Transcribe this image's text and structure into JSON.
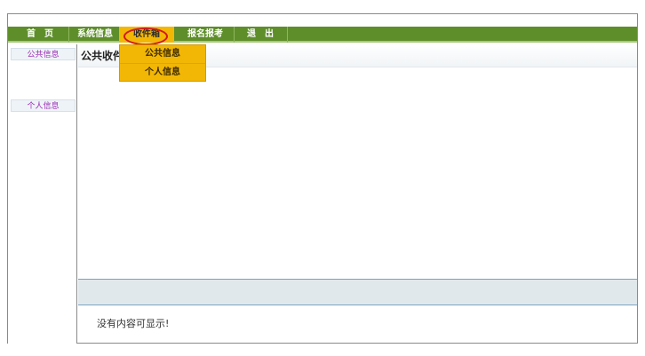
{
  "nav": {
    "items": [
      {
        "label": "首　页"
      },
      {
        "label": "系统信息"
      },
      {
        "label": "收件箱"
      },
      {
        "label": "报名报考"
      },
      {
        "label": "退　出"
      }
    ]
  },
  "dropdown": {
    "items": [
      {
        "label": "公共信息"
      },
      {
        "label": "个人信息"
      }
    ]
  },
  "sidebar": {
    "items": [
      {
        "label": "公共信息"
      },
      {
        "label": "个人信息"
      }
    ]
  },
  "content": {
    "title": "公共收件箱",
    "empty_message": "没有内容可显示!"
  },
  "colors": {
    "nav_green": "#5e8e2a",
    "active_yellow": "#f2b705",
    "highlight_ring": "#d11b1b"
  }
}
